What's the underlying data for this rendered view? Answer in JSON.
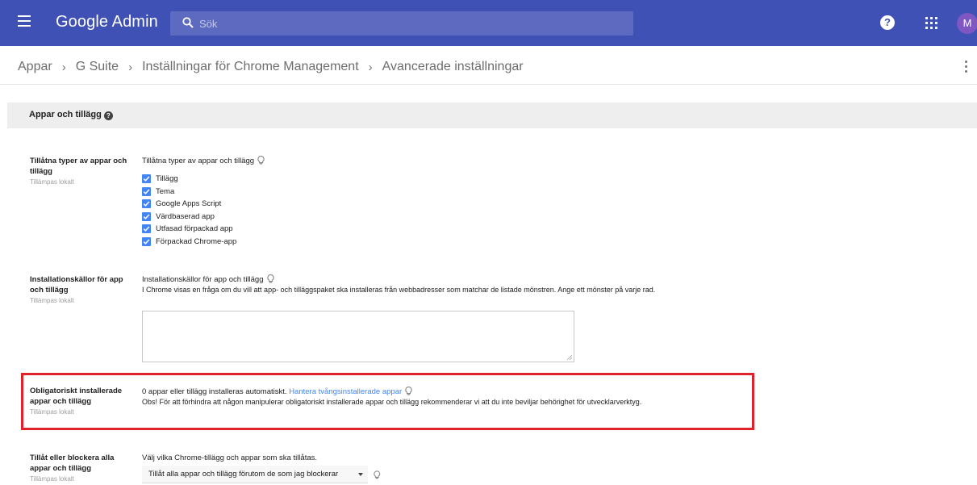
{
  "header": {
    "app_title": "Google Admin",
    "search_placeholder": "Sök",
    "help_label": "?",
    "avatar_initial": "M",
    "bar_color": "#3f51b5"
  },
  "breadcrumb": {
    "items": [
      "Appar",
      "G Suite",
      "Inställningar för Chrome Management",
      "Avancerade inställningar"
    ],
    "separator": "›"
  },
  "section": {
    "title": "Appar och tillägg",
    "info_icon": "help-circle-icon"
  },
  "settings": [
    {
      "label": "Tillåtna typer av appar och tillägg",
      "scope": "Tillämpas lokalt",
      "content_title": "Tillåtna typer av appar och tillägg",
      "checkboxes": [
        {
          "label": "Tillägg",
          "checked": true
        },
        {
          "label": "Tema",
          "checked": true
        },
        {
          "label": "Google Apps Script",
          "checked": true
        },
        {
          "label": "Värdbaserad app",
          "checked": true
        },
        {
          "label": "Utfasad förpackad app",
          "checked": true
        },
        {
          "label": "Förpackad Chrome-app",
          "checked": true
        }
      ]
    },
    {
      "label": "Installationskällor för app och tillägg",
      "scope": "Tillämpas lokalt",
      "content_title": "Installationskällor för app och tillägg",
      "description": "I Chrome visas en fråga om du vill att app- och tilläggspaket ska installeras från webbadresser som matchar de listade mönstren. Ange ett mönster på varje rad.",
      "textarea_value": ""
    },
    {
      "label": "Obligatoriskt installerade appar och tillägg",
      "scope": "Tillämpas lokalt",
      "line1_prefix": "0 appar eller tillägg installeras automatiskt.",
      "link_text": "Hantera tvångsinstallerade appar",
      "note": "Obs! För att förhindra att någon manipulerar obligatoriskt installerade appar och tillägg rekommenderar vi att du inte beviljar behörighet för utvecklarverktyg.",
      "highlight_color": "#e0222b"
    },
    {
      "label": "Tillåt eller blockera alla appar och tillägg",
      "scope": "Tillämpas lokalt",
      "content_title": "Välj vilka Chrome-tillägg och appar som ska tillåtas.",
      "select_value": "Tillåt alla appar och tillägg förutom de som jag blockerar"
    }
  ]
}
